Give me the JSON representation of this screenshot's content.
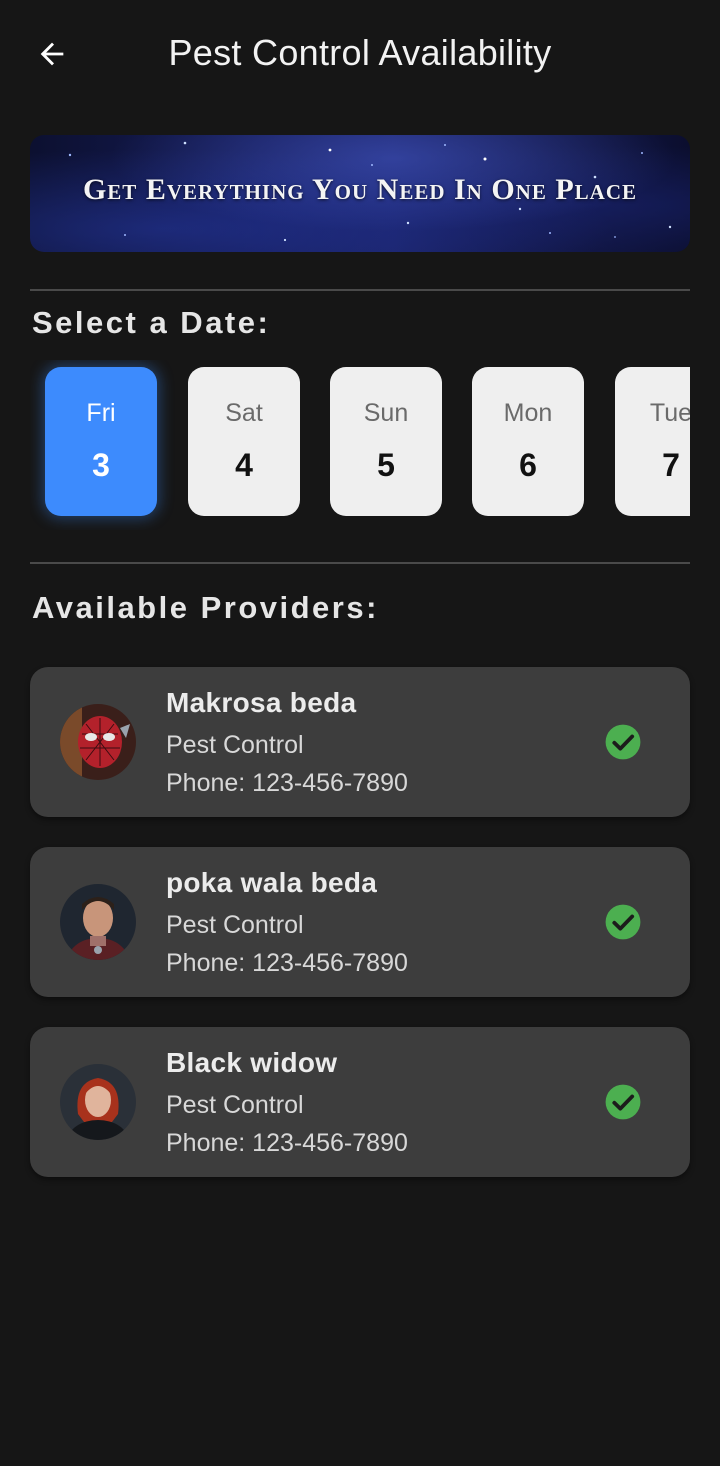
{
  "header": {
    "title": "Pest Control Availability",
    "back_icon": "arrow-left-icon"
  },
  "banner": {
    "text": "Get Everything You Need In One Place"
  },
  "date_section": {
    "title": "Select a Date:",
    "dates": [
      {
        "day": "Fri",
        "num": "3",
        "selected": true
      },
      {
        "day": "Sat",
        "num": "4",
        "selected": false
      },
      {
        "day": "Sun",
        "num": "5",
        "selected": false
      },
      {
        "day": "Mon",
        "num": "6",
        "selected": false
      },
      {
        "day": "Tue",
        "num": "7",
        "selected": false
      }
    ]
  },
  "providers_section": {
    "title": "Available Providers:",
    "providers": [
      {
        "name": "Makrosa beda",
        "service": "Pest Control",
        "phone": "Phone: 123-456-7890",
        "available": true
      },
      {
        "name": "poka wala beda",
        "service": "Pest Control",
        "phone": "Phone: 123-456-7890",
        "available": true
      },
      {
        "name": "Black widow",
        "service": "Pest Control",
        "phone": "Phone: 123-456-7890",
        "available": true
      }
    ]
  },
  "colors": {
    "background": "#161616",
    "accent": "#3d8bfd",
    "card": "#3d3d3d",
    "available": "#4caf50"
  }
}
